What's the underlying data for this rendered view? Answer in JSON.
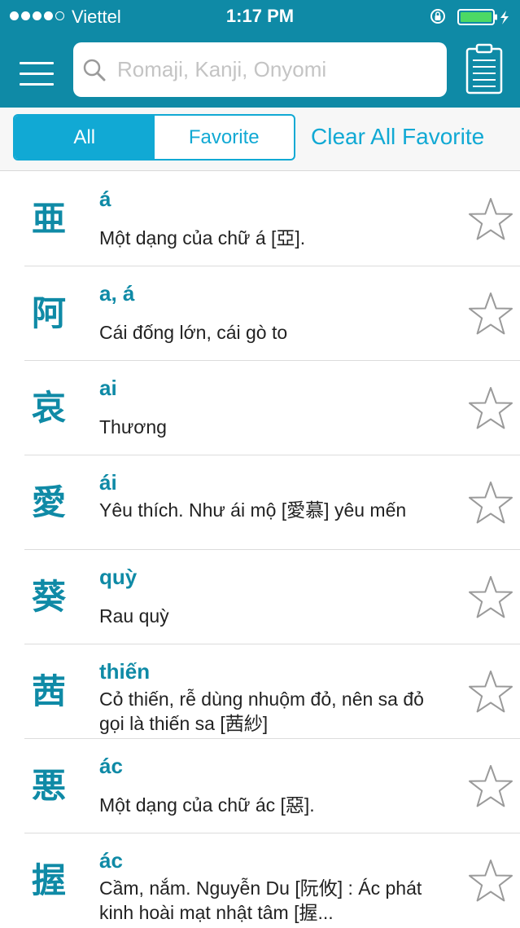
{
  "status_bar": {
    "carrier": "Viettel",
    "time": "1:17 PM"
  },
  "search": {
    "placeholder": "Romaji, Kanji, Onyomi",
    "value": ""
  },
  "filter": {
    "tabs": [
      {
        "label": "All",
        "selected": true
      },
      {
        "label": "Favorite",
        "selected": false
      }
    ],
    "clear_label": "Clear All Favorite"
  },
  "icons": {
    "menu": "menu-icon",
    "search": "search-icon",
    "clipboard": "clipboard-icon",
    "favorite": "star-icon"
  },
  "colors": {
    "header": "#0f8aa6",
    "accent": "#11a9d4",
    "kanji": "#0f8aa6"
  },
  "entries": [
    {
      "kanji": "亜",
      "reading": "á",
      "meaning": "Một dạng của chữ á [亞].",
      "favorite": false
    },
    {
      "kanji": "阿",
      "reading": "a, á",
      "meaning": "Cái đống lớn, cái gò to",
      "favorite": false
    },
    {
      "kanji": "哀",
      "reading": "ai",
      "meaning": "Thương",
      "favorite": false
    },
    {
      "kanji": "愛",
      "reading": "ái",
      "meaning": "Yêu thích. Như ái mộ [愛慕] yêu mến",
      "favorite": false
    },
    {
      "kanji": "葵",
      "reading": "quỳ",
      "meaning": "Rau quỳ",
      "favorite": false
    },
    {
      "kanji": "茜",
      "reading": "thiến",
      "meaning": "Cỏ thiến, rễ dùng nhuộm đỏ, nên sa đỏ gọi là thiến sa [茜紗]",
      "favorite": false
    },
    {
      "kanji": "悪",
      "reading": "ác",
      "meaning": "Một dạng của chữ ác [惡].",
      "favorite": false
    },
    {
      "kanji": "握",
      "reading": "ác",
      "meaning": "Cầm, nắm. Nguyễn Du [阮攸] : Ác phát kinh hoài mạt nhật tâm [握...",
      "favorite": false
    }
  ]
}
